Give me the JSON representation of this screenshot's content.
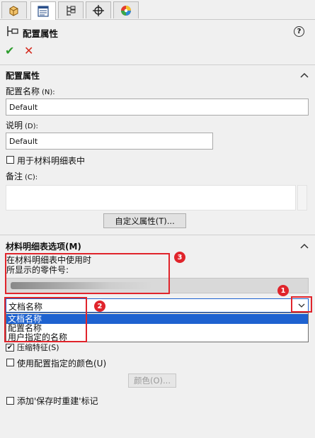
{
  "header": {
    "title": "配置属性",
    "help_glyph": "?",
    "ok_glyph": "✔",
    "cancel_glyph": "✕",
    "icons": [
      "feature-manager-icon",
      "property-manager-icon",
      "configuration-manager-icon",
      "dimxpert-icon",
      "display-manager-icon"
    ]
  },
  "config_props": {
    "title": "配置属性",
    "name_label": "配置名称",
    "name_hotkey": "(N):",
    "name_value": "Default",
    "desc_label": "说明",
    "desc_hotkey": "(D):",
    "desc_value": "Default",
    "use_in_bom_label": "用于材料明细表中",
    "notes_label": "备注",
    "notes_hotkey": "(C):",
    "custom_props_button": "自定义属性(T)..."
  },
  "bom_options": {
    "title": "材料明细表选项(M)",
    "partno_label_line1": "在材料明细表中使用时",
    "partno_label_line2": "所显示的零件号:",
    "partno_value": "",
    "select_value": "文档名称",
    "options": [
      "文档名称",
      "配置名称",
      "用户指定的名称"
    ],
    "suppress_label": "压缩特征(S)",
    "use_color_label": "使用配置指定的颜色(U)",
    "color_button": "颜色(O)...",
    "rebuild_mark_label": "添加'保存时重建'标记"
  },
  "annotations": {
    "badge1": "1",
    "badge2": "2",
    "badge3": "3"
  },
  "colors": {
    "highlight": "#1e62d0",
    "annotation_red": "#e0242b",
    "ok_green": "#2e9d2e",
    "cancel_red": "#d42a1d"
  }
}
